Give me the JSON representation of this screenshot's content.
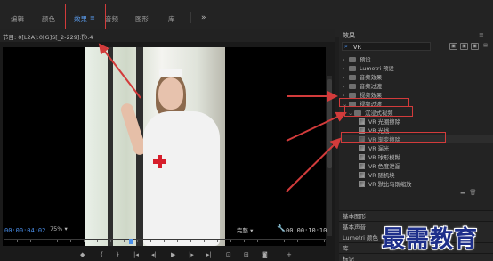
{
  "workspace_tabs": [
    {
      "label": "编辑",
      "active": false
    },
    {
      "label": "颜色",
      "active": false
    },
    {
      "label": "效果",
      "active": true
    },
    {
      "label": "音频",
      "active": false
    },
    {
      "label": "图形",
      "active": false
    },
    {
      "label": "库",
      "active": false
    }
  ],
  "workspace_menu_icon": "≡",
  "workspace_more": "»",
  "program": {
    "title": "节目: 0[L2A]:0[G]S[_2-229]:[0.4",
    "menu_icon": "≡",
    "timecode_current": "00:00:04:02",
    "zoom": "75%",
    "quality": "完整",
    "timecode_duration": "00:00:10:10",
    "playhead_fraction": 0.39,
    "transport_buttons": [
      "mark-in",
      "mark-out",
      "go-to-in",
      "step-back",
      "play",
      "step-forward",
      "go-to-out",
      "insert",
      "overwrite",
      "export-frame",
      "add"
    ]
  },
  "effects": {
    "title": "效果",
    "menu_icon": "≡",
    "search_value": "VR",
    "tree": [
      {
        "label": "预设",
        "level": 0,
        "type": "folder",
        "expanded": false
      },
      {
        "label": "Lumetri 预设",
        "level": 0,
        "type": "folder",
        "expanded": false
      },
      {
        "label": "音频效果",
        "level": 0,
        "type": "folder",
        "expanded": false
      },
      {
        "label": "音频过渡",
        "level": 0,
        "type": "folder",
        "expanded": false
      },
      {
        "label": "视频效果",
        "level": 0,
        "type": "folder",
        "expanded": false
      },
      {
        "label": "视频过渡",
        "level": 0,
        "type": "folder",
        "expanded": true
      },
      {
        "label": "沉浸式视频",
        "level": 1,
        "type": "folder",
        "expanded": true
      },
      {
        "label": "VR 光圈擦除",
        "level": 2,
        "type": "effect"
      },
      {
        "label": "VR 光线",
        "level": 2,
        "type": "effect"
      },
      {
        "label": "VR 渐变擦除",
        "level": 2,
        "type": "effect",
        "selected": true
      },
      {
        "label": "VR 漏光",
        "level": 2,
        "type": "effect"
      },
      {
        "label": "VR 球形模糊",
        "level": 2,
        "type": "effect"
      },
      {
        "label": "VR 色度泄漏",
        "level": 2,
        "type": "effect"
      },
      {
        "label": "VR 随机块",
        "level": 2,
        "type": "effect"
      },
      {
        "label": "VR 默比乌斯缩放",
        "level": 2,
        "type": "effect"
      }
    ],
    "bottom_panels": [
      "基本图形",
      "基本声音",
      "Lumetri 颜色",
      "库",
      "标记"
    ]
  },
  "watermark": "最需教育",
  "colors": {
    "accent_blue": "#4a8fea",
    "highlight_red": "#d23b3b",
    "watermark_blue": "#1e2f8a"
  }
}
